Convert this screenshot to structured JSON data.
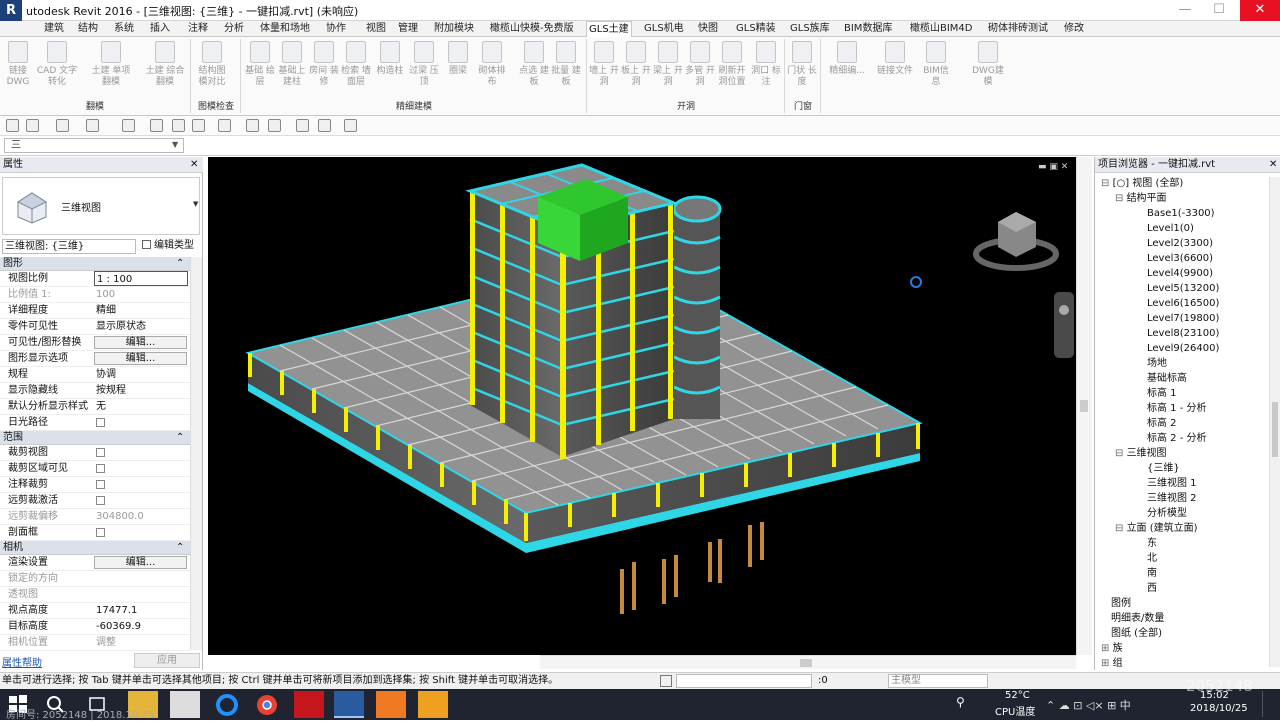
{
  "window": {
    "title": "utodesk Revit 2016 - [三维视图: {三维} - 一键扣减.rvt] (未响应)",
    "minimize": "—",
    "maximize": "☐",
    "close": "✕"
  },
  "tabs": [
    "建筑",
    "结构",
    "系统",
    "插入",
    "注释",
    "分析",
    "体量和场地",
    "协作",
    "视图",
    "管理",
    "附加模块",
    "橄榄山快模-免费版",
    "GLS土建",
    "GLS机电",
    "快图",
    "GLS精装",
    "GLS族库",
    "BIM数据库",
    "橄榄山BIM4D",
    "砌体排砖测试",
    "修改"
  ],
  "active_tab": "GLS土建",
  "ribbon": {
    "tools": [
      "链接 DWG",
      "CAD 文字转化",
      "土建 单项翻模",
      "土建 综合翻模",
      "结构图 模对比",
      "基础 绘层",
      "基础上 建柱",
      "房间 装修",
      "检索 墙面层",
      "构造柱",
      "过梁 压顶",
      "圈梁",
      "砌体排布",
      "点选 建板",
      "批量 建板",
      "墙上 开洞",
      "板上 开洞",
      "梁上 开洞",
      "多管 开洞",
      "刷新开 洞位置",
      "洞口 标注",
      "门状 长度",
      "精细编...",
      "链接文件",
      "BIM信息",
      "DWG建模"
    ],
    "groups": [
      "翻模",
      "图模检查",
      "精细建模",
      "开洞",
      "门窗"
    ]
  },
  "type_selector": "三",
  "properties": {
    "header": "属性",
    "close": "✕",
    "type_name": "三维视图",
    "instance": "三维视图: {三维}",
    "edit_type": "编辑类型",
    "section_graphics": "图形",
    "section_extents": "范围",
    "section_camera": "相机",
    "rows_graphics": [
      {
        "k": "视图比例",
        "v": "1 : 100",
        "input": true
      },
      {
        "k": "比例值 1:",
        "v": "100",
        "dim": true
      },
      {
        "k": "详细程度",
        "v": "精细"
      },
      {
        "k": "零件可见性",
        "v": "显示原状态"
      },
      {
        "k": "可见性/图形替换",
        "v": "编辑...",
        "btn": true
      },
      {
        "k": "图形显示选项",
        "v": "编辑...",
        "btn": true
      },
      {
        "k": "规程",
        "v": "协调"
      },
      {
        "k": "显示隐藏线",
        "v": "按规程"
      },
      {
        "k": "默认分析显示样式",
        "v": "无"
      },
      {
        "k": "日光路径",
        "v": "",
        "cb": true
      }
    ],
    "rows_extents": [
      {
        "k": "裁剪视图",
        "v": "",
        "cb": true
      },
      {
        "k": "裁剪区域可见",
        "v": "",
        "cb": true
      },
      {
        "k": "注释裁剪",
        "v": "",
        "cb": true
      },
      {
        "k": "远剪裁激活",
        "v": "",
        "cb": true
      },
      {
        "k": "远剪裁偏移",
        "v": "304800.0",
        "dim": true
      },
      {
        "k": "剖面框",
        "v": "",
        "cb": true
      }
    ],
    "rows_camera": [
      {
        "k": "渲染设置",
        "v": "编辑...",
        "btn": true
      },
      {
        "k": "锁定的方向",
        "v": "",
        "dim": true
      },
      {
        "k": "透视图",
        "v": "",
        "dim": true
      },
      {
        "k": "视点高度",
        "v": "17477.1"
      },
      {
        "k": "目标高度",
        "v": "-60369.9"
      },
      {
        "k": "相机位置",
        "v": "调整",
        "dim": true
      }
    ],
    "help": "属性帮助",
    "apply": "应用"
  },
  "browser": {
    "header": "项目浏览器 - 一键扣减.rvt",
    "close": "✕",
    "items": [
      {
        "text": "[○] 视图 (全部)",
        "indent": 0,
        "toggle": "⊟"
      },
      {
        "text": "结构平面",
        "indent": 1,
        "toggle": "⊟"
      },
      {
        "text": "Base1(-3300)",
        "indent": 2
      },
      {
        "text": "Level1(0)",
        "indent": 2
      },
      {
        "text": "Level2(3300)",
        "indent": 2
      },
      {
        "text": "Level3(6600)",
        "indent": 2
      },
      {
        "text": "Level4(9900)",
        "indent": 2
      },
      {
        "text": "Level5(13200)",
        "indent": 2
      },
      {
        "text": "Level6(16500)",
        "indent": 2
      },
      {
        "text": "Level7(19800)",
        "indent": 2
      },
      {
        "text": "Level8(23100)",
        "indent": 2
      },
      {
        "text": "Level9(26400)",
        "indent": 2
      },
      {
        "text": "场地",
        "indent": 2
      },
      {
        "text": "基础标高",
        "indent": 2
      },
      {
        "text": "标高 1",
        "indent": 2
      },
      {
        "text": "标高 1 - 分析",
        "indent": 2
      },
      {
        "text": "标高 2",
        "indent": 2
      },
      {
        "text": "标高 2 - 分析",
        "indent": 2
      },
      {
        "text": "三维视图",
        "indent": 1,
        "toggle": "⊟"
      },
      {
        "text": "{三维}",
        "indent": 2
      },
      {
        "text": "三维视图 1",
        "indent": 2
      },
      {
        "text": "三维视图 2",
        "indent": 2
      },
      {
        "text": "分析模型",
        "indent": 2
      },
      {
        "text": "立面 (建筑立面)",
        "indent": 1,
        "toggle": "⊟"
      },
      {
        "text": "东",
        "indent": 2
      },
      {
        "text": "北",
        "indent": 2
      },
      {
        "text": "南",
        "indent": 2
      },
      {
        "text": "西",
        "indent": 2
      },
      {
        "text": "图例",
        "indent": 0
      },
      {
        "text": "明细表/数量",
        "indent": 0
      },
      {
        "text": "图纸 (全部)",
        "indent": 0
      },
      {
        "text": "族",
        "indent": 0,
        "toggle": "⊞"
      },
      {
        "text": "组",
        "indent": 0,
        "toggle": "⊞"
      },
      {
        "text": "Revit 链接",
        "indent": 0
      }
    ]
  },
  "status": {
    "message": "单击可进行选择; 按 Tab 键并单击可选择其他项目; 按 Ctrl 键并单击可将新项目添加到选择集; 按 Shift 键并单击可取消选择。",
    "count": ":0",
    "model": "主模型"
  },
  "taskbar": {
    "overlay": "房间号: 2052148 | 2018.10.25",
    "temp": "52°C",
    "cpu": "CPU温度",
    "time": "15:02",
    "date": "2018/10/25",
    "watermark_num": "2052148"
  },
  "colors": {
    "cyan": "#2fd6e6",
    "yellow": "#f4f000",
    "green": "#2ec82e",
    "accent_red": "#e81123"
  }
}
